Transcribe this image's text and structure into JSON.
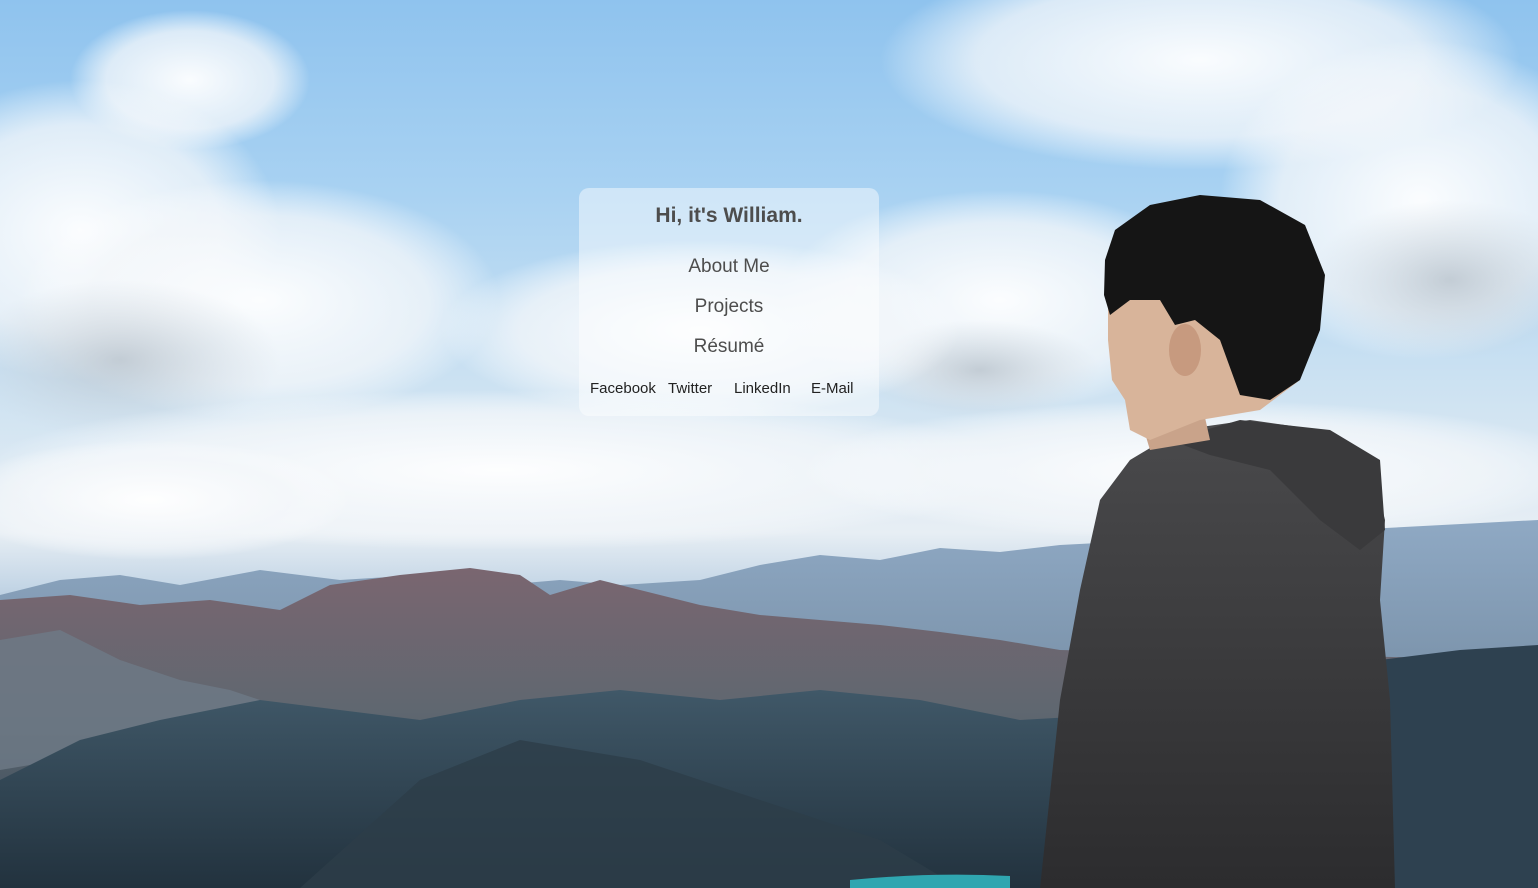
{
  "hero": {
    "title": "Hi, it's William."
  },
  "nav": {
    "items": [
      {
        "label": "About Me"
      },
      {
        "label": "Projects"
      },
      {
        "label": "Résumé"
      }
    ]
  },
  "social": {
    "links": [
      {
        "label": "Facebook"
      },
      {
        "label": "Twitter"
      },
      {
        "label": "LinkedIn"
      },
      {
        "label": "E-Mail"
      }
    ]
  },
  "colors": {
    "sky": "#8fc3ee",
    "card_text": "#4d4d4d",
    "social_text": "#222222",
    "lake": "#2fa6b0"
  }
}
